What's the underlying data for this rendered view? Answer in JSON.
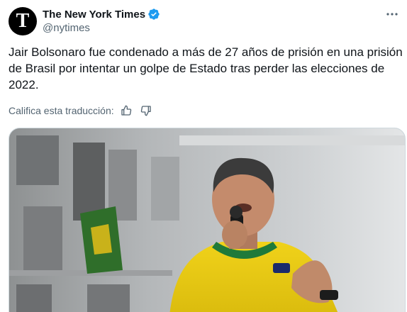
{
  "author": {
    "display_name": "The New York Times",
    "handle": "@nytimes",
    "avatar_glyph": "T",
    "verified": true
  },
  "tweet": {
    "text": "Jair Bolsonaro fue condenado a más de 27 años de prisión en una prisión de Brasil por intentar un golpe de Estado tras perder las elecciones de 2022."
  },
  "translation": {
    "rate_label": "Califica esta traducción:",
    "thumbs_up_icon": "thumbs-up-icon",
    "thumbs_down_icon": "thumbs-down-icon"
  },
  "colors": {
    "verified_blue": "#1d9bf0",
    "text": "#0f1419",
    "muted": "#536471"
  }
}
